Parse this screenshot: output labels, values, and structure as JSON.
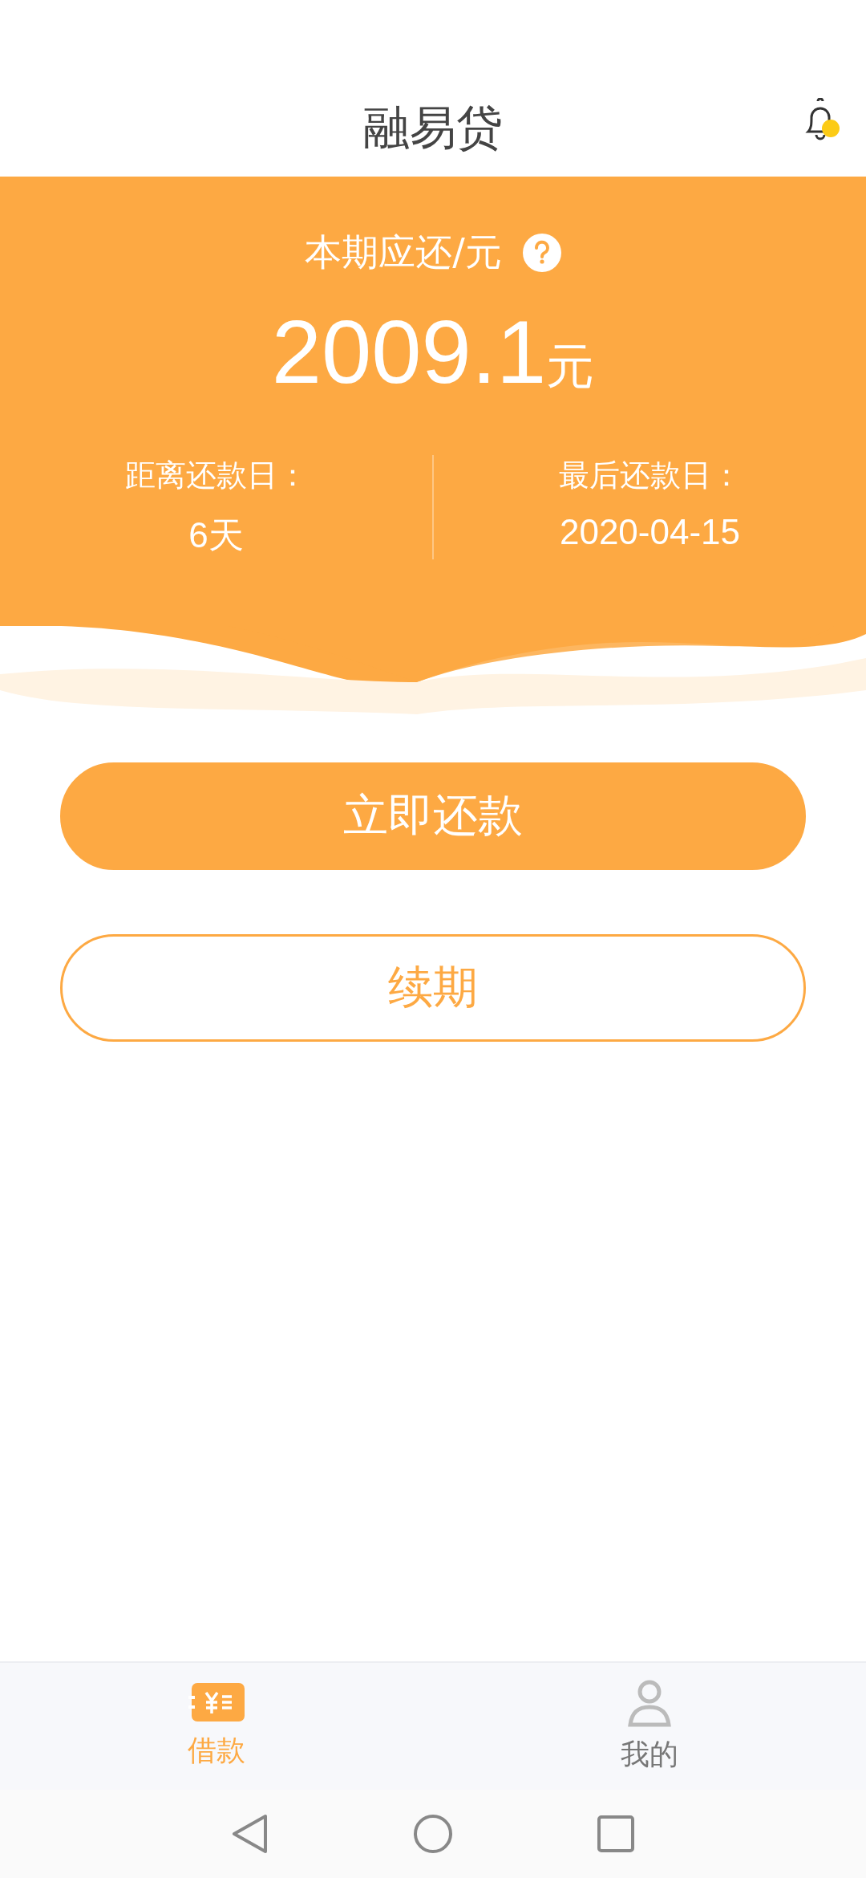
{
  "header": {
    "title": "融易贷",
    "notification_unread": true
  },
  "summary": {
    "label": "本期应还/元",
    "amount": "2009.1",
    "unit": "元",
    "details": [
      {
        "label": "距离还款日：",
        "value": "6天"
      },
      {
        "label": "最后还款日：",
        "value": "2020-04-15"
      }
    ]
  },
  "actions": [
    {
      "label": "立即还款",
      "kind": "primary"
    },
    {
      "label": "续期",
      "kind": "outline"
    }
  ],
  "tabs": [
    {
      "label": "借款",
      "kind": "loan",
      "selected": true
    },
    {
      "label": "我的",
      "kind": "profile",
      "selected": false
    }
  ]
}
